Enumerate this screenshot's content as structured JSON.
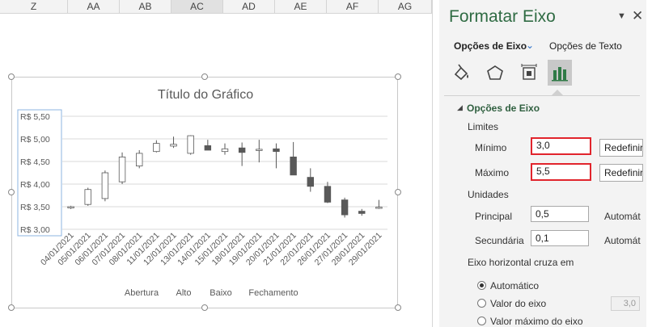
{
  "sheet": {
    "columns": [
      "Z",
      "AA",
      "AB",
      "AC",
      "AD",
      "AE",
      "AF",
      "AG"
    ],
    "selected_column": "AC"
  },
  "chart": {
    "title": "Título do Gráfico",
    "legend": [
      "Abertura",
      "Alto",
      "Baixo",
      "Fechamento"
    ]
  },
  "chart_data": {
    "type": "candlestick",
    "title": "Título do Gráfico",
    "y_tick_labels": [
      "R$ 5,50",
      "R$ 5,00",
      "R$ 4,50",
      "R$ 4,00",
      "R$ 3,50",
      "R$ 3,00"
    ],
    "ylim": [
      3.0,
      5.5
    ],
    "grid": true,
    "legend_position": "bottom",
    "series_names": [
      "Abertura",
      "Alto",
      "Baixo",
      "Fechamento"
    ],
    "categories": [
      "04/01/2021",
      "05/01/2021",
      "06/01/2021",
      "07/01/2021",
      "08/01/2021",
      "11/01/2021",
      "12/01/2021",
      "13/01/2021",
      "14/01/2021",
      "15/01/2021",
      "18/01/2021",
      "19/01/2021",
      "20/01/2021",
      "21/01/2021",
      "22/01/2021",
      "26/01/2021",
      "27/01/2021",
      "28/01/2021",
      "29/01/2021"
    ],
    "open": [
      3.48,
      3.55,
      3.68,
      4.05,
      4.4,
      4.72,
      4.84,
      4.68,
      4.85,
      4.72,
      4.8,
      4.76,
      4.78,
      4.6,
      4.15,
      3.95,
      3.65,
      3.4,
      3.47
    ],
    "high": [
      3.52,
      3.92,
      4.3,
      4.7,
      4.75,
      4.97,
      5.05,
      5.08,
      4.98,
      4.9,
      4.92,
      4.98,
      4.9,
      4.93,
      4.35,
      4.05,
      3.7,
      3.45,
      3.65
    ],
    "low": [
      3.45,
      3.52,
      3.62,
      4.0,
      4.35,
      4.7,
      4.8,
      4.65,
      4.75,
      4.65,
      4.4,
      4.48,
      4.35,
      4.27,
      3.83,
      3.58,
      3.26,
      3.3,
      3.45
    ],
    "close": [
      3.5,
      3.88,
      4.25,
      4.6,
      4.68,
      4.9,
      4.88,
      5.07,
      4.75,
      4.78,
      4.7,
      4.77,
      4.72,
      4.2,
      3.95,
      3.6,
      3.32,
      3.35,
      3.49
    ]
  },
  "pane": {
    "title": "Formatar Eixo",
    "tabs": [
      "Opções de Eixo",
      "Opções de Texto"
    ],
    "section_title": "Opções de Eixo",
    "limits_label": "Limites",
    "min_label": "Mínimo",
    "min_value": "3,0",
    "max_label": "Máximo",
    "max_value": "5,5",
    "reset_label": "Redefinir",
    "units_label": "Unidades",
    "major_label": "Principal",
    "major_value": "0,5",
    "minor_label": "Secundária",
    "minor_value": "0,1",
    "auto_label": "Automát",
    "cross_label": "Eixo horizontal cruza em",
    "radio_auto": "Automático",
    "radio_value": "Valor do eixo",
    "radio_value_field": "3,0",
    "radio_max": "Valor máximo do eixo"
  },
  "colors": {
    "accent_green": "#2f6b43",
    "highlight_red": "#e1242c",
    "candle_dark": "#595959"
  }
}
